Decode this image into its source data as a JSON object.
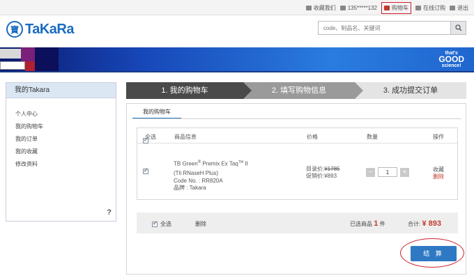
{
  "topbar": {
    "links": [
      {
        "label": "收藏我们",
        "icon": "bookmark-icon"
      },
      {
        "label": "135*****132",
        "icon": "user-icon"
      },
      {
        "label": "购物车",
        "icon": "cart-icon"
      },
      {
        "label": "在线订购",
        "icon": "order-icon"
      },
      {
        "label": "退出",
        "icon": "logout-icon"
      }
    ]
  },
  "header": {
    "logo_text": "TaKaRa",
    "search_placeholder": "code、制品名、关键词"
  },
  "banner": {
    "line1": "that's",
    "line2": "GOOD",
    "line3": "science!"
  },
  "sidebar": {
    "title": "我的Takara",
    "items": [
      "个人中心",
      "我的购物车",
      "我的订单",
      "我的收藏",
      "修改资料"
    ],
    "help": "?"
  },
  "steps": [
    "1. 我的购物车",
    "2. 填写购物信息",
    "3. 成功提交订单"
  ],
  "panel": {
    "tab": "我的购物车",
    "table": {
      "headers": {
        "select_all": "全选",
        "product": "商品信息",
        "price": "价格",
        "quantity": "数量",
        "action": "操作"
      },
      "item": {
        "name_line1": "TB Green",
        "name_reg": "®",
        "name_mid": " Premix Ex Taq",
        "name_tm": "TM",
        "name_end": " II",
        "name_line2": "(Tli RNaseH Plus)",
        "code": "Code No. :  RR820A",
        "brand": "品牌 :  Takara",
        "list_price_label": "目录价:",
        "list_price": "¥1785",
        "promo_price_label": "促销价:",
        "promo_price": "¥893",
        "quantity": "1",
        "minus": "−",
        "plus": "+",
        "favorite": "收藏",
        "delete": "删除"
      }
    },
    "summary": {
      "select_all": "全选",
      "delete": "删除",
      "selected_prefix": "已选商品",
      "selected_count": "1",
      "selected_suffix": "件",
      "total_label": "合计:",
      "total": "¥ 893"
    },
    "checkout": "结 算"
  },
  "colors": {
    "accent": "#2f79c4",
    "price_red": "#c0392b",
    "highlight_ring": "#cc1f2f"
  }
}
